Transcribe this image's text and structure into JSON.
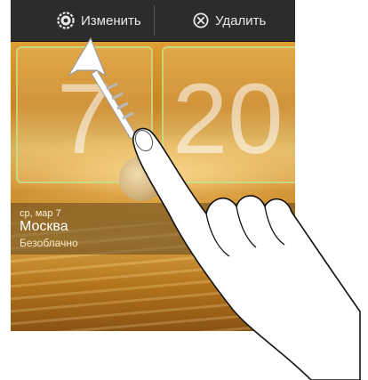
{
  "topbar": {
    "edit_label": "Изменить",
    "delete_label": "Удалить"
  },
  "clock": {
    "hour": "7",
    "minute": "20"
  },
  "weather": {
    "date": "ср, мар 7",
    "city": "Москва",
    "condition": "Безоблачно"
  },
  "icons": {
    "edit": "gear-icon",
    "delete": "close-circle-icon",
    "gesture": "swipe-up-arrow",
    "hand": "hand-pointer"
  },
  "colors": {
    "topbar_bg": "#2c2c2c",
    "topbar_text": "#e8e8e8",
    "panel_border": "#bee68c"
  }
}
